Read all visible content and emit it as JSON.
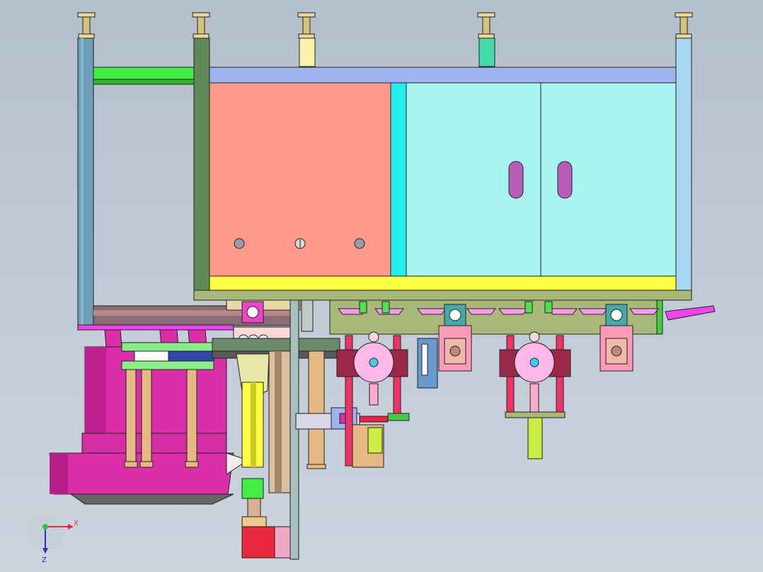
{
  "triad": {
    "x_label": "X",
    "z_label": "Z"
  },
  "colors": {
    "background": "#bfc9d4",
    "frame_post": "#6f9fb8",
    "panel_salmon": "#ff9a8c",
    "panel_cyan": "#a8f4ee",
    "rail_yellow": "#ffff44",
    "bracket_blue": "#9fb3ee",
    "bar_green": "#44ee44",
    "base_olive": "#a8b878",
    "magenta": "#dd2eaa",
    "pink_wheel": "#ffb8e8",
    "red_block": "#e8283c",
    "tan_rod": "#e6b884"
  }
}
